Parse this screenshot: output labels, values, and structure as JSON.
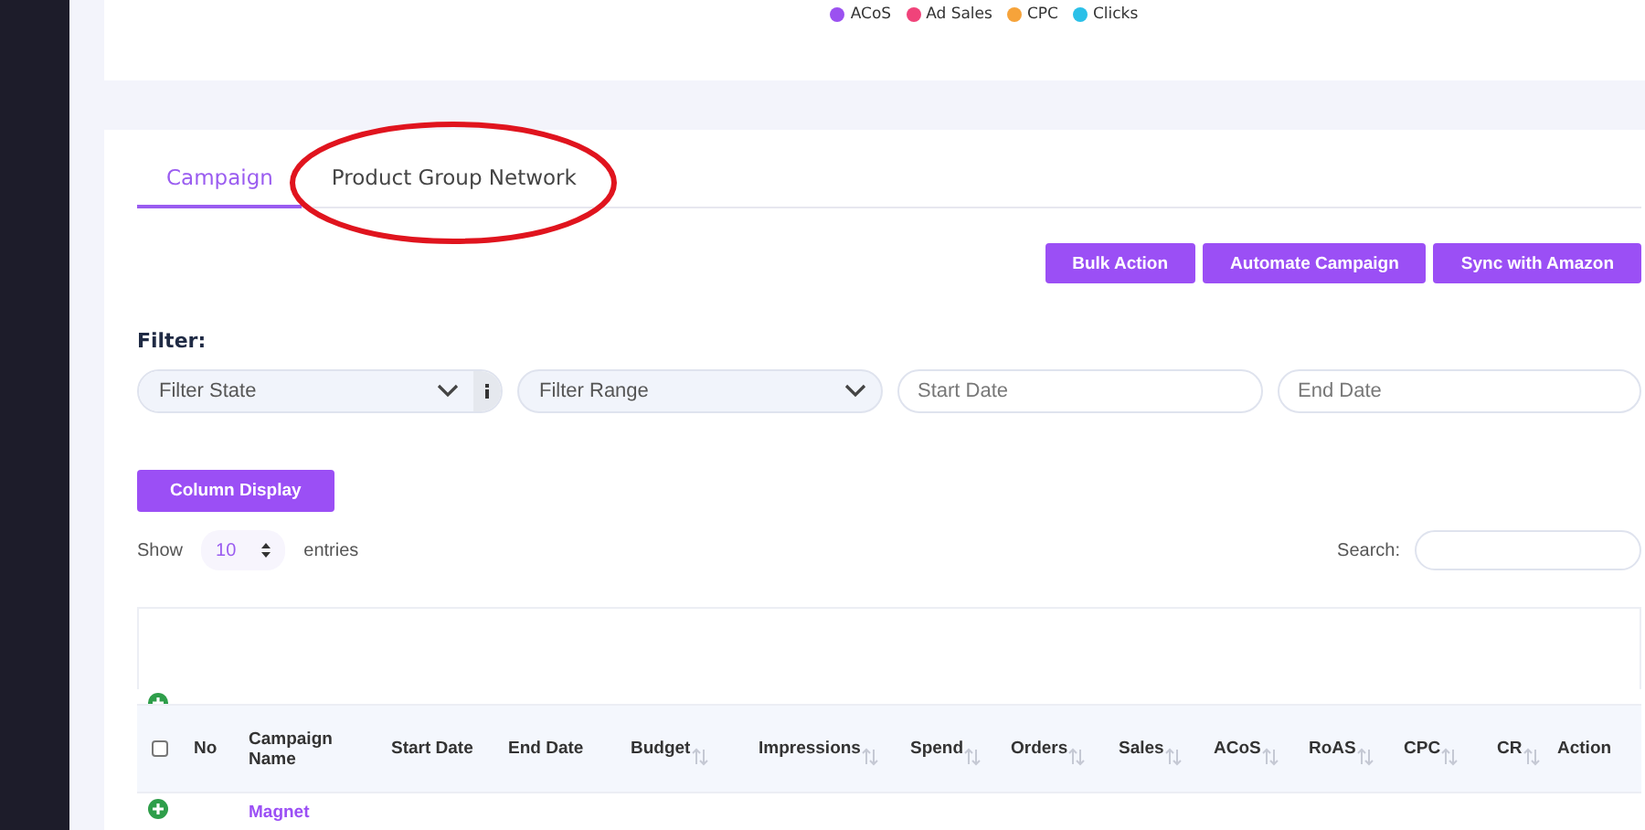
{
  "legend": [
    {
      "label": "ACoS",
      "color": "#9b51f0"
    },
    {
      "label": "Ad Sales",
      "color": "#f0437a"
    },
    {
      "label": "CPC",
      "color": "#f6a33a"
    },
    {
      "label": "Clicks",
      "color": "#2bc0e8"
    }
  ],
  "tabs": [
    {
      "label": "Campaign",
      "selected": true,
      "circled": false
    },
    {
      "label": "Product Group Network",
      "selected": false,
      "circled": true
    }
  ],
  "actions": [
    "Bulk Action",
    "Automate Campaign",
    "Sync with Amazon"
  ],
  "filter": {
    "label": "Filter:",
    "state_select": "Filter State",
    "range_select": "Filter Range",
    "start_date": {
      "placeholder": "Start Date"
    },
    "end_date": {
      "placeholder": "End Date"
    }
  },
  "column_display": "Column Display",
  "length": {
    "show": "Show",
    "value": "10",
    "entries": "entries"
  },
  "search": {
    "label": "Search:"
  },
  "table": {
    "select_all_checked": false,
    "columns": [
      {
        "label": "No",
        "sortable": false
      },
      {
        "label": "Campaign Name",
        "sortable": false
      },
      {
        "label": "Start Date",
        "sortable": false
      },
      {
        "label": "End Date",
        "sortable": false
      },
      {
        "label": "Budget",
        "sortable": true
      },
      {
        "label": "Impressions",
        "sortable": true
      },
      {
        "label": "Spend",
        "sortable": true
      },
      {
        "label": "Orders",
        "sortable": true
      },
      {
        "label": "Sales",
        "sortable": true
      },
      {
        "label": "ACoS",
        "sortable": true
      },
      {
        "label": "RoAS",
        "sortable": true
      },
      {
        "label": "CPC",
        "sortable": true
      },
      {
        "label": "CR",
        "sortable": true
      },
      {
        "label": "Action",
        "sortable": false
      }
    ],
    "rows": [
      {
        "campaign_name": "Magnet"
      }
    ]
  }
}
